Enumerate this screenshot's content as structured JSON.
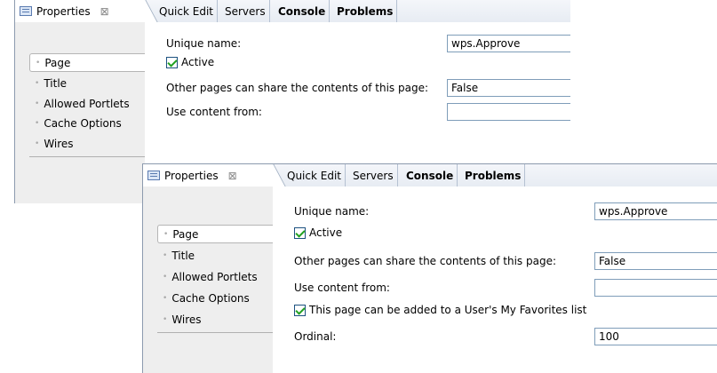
{
  "panels": [
    {
      "view_tab": {
        "label": "Properties",
        "close": "⊠"
      },
      "tabs": [
        "Quick Edit",
        "Servers",
        "Console",
        "Problems"
      ],
      "sidebar": [
        "Page",
        "Title",
        "Allowed Portlets",
        "Cache Options",
        "Wires"
      ],
      "form": {
        "unique_name_label": "Unique name:",
        "unique_name_value": "wps.Approve",
        "active_label": "Active",
        "share_label": "Other pages can share the contents of this page:",
        "share_value": "False",
        "content_from_label": "Use content from:"
      }
    },
    {
      "view_tab": {
        "label": "Properties",
        "close": "⊠"
      },
      "tabs": [
        "Quick Edit",
        "Servers",
        "Console",
        "Problems"
      ],
      "sidebar": [
        "Page",
        "Title",
        "Allowed Portlets",
        "Cache Options",
        "Wires"
      ],
      "form": {
        "unique_name_label": "Unique name:",
        "unique_name_value": "wps.Approve",
        "active_label": "Active",
        "share_label": "Other pages can share the contents of this page:",
        "share_value": "False",
        "content_from_label": "Use content from:",
        "favorites_label": "This page can be added to a User's My Favorites list",
        "ordinal_label": "Ordinal:",
        "ordinal_value": "100"
      }
    }
  ]
}
